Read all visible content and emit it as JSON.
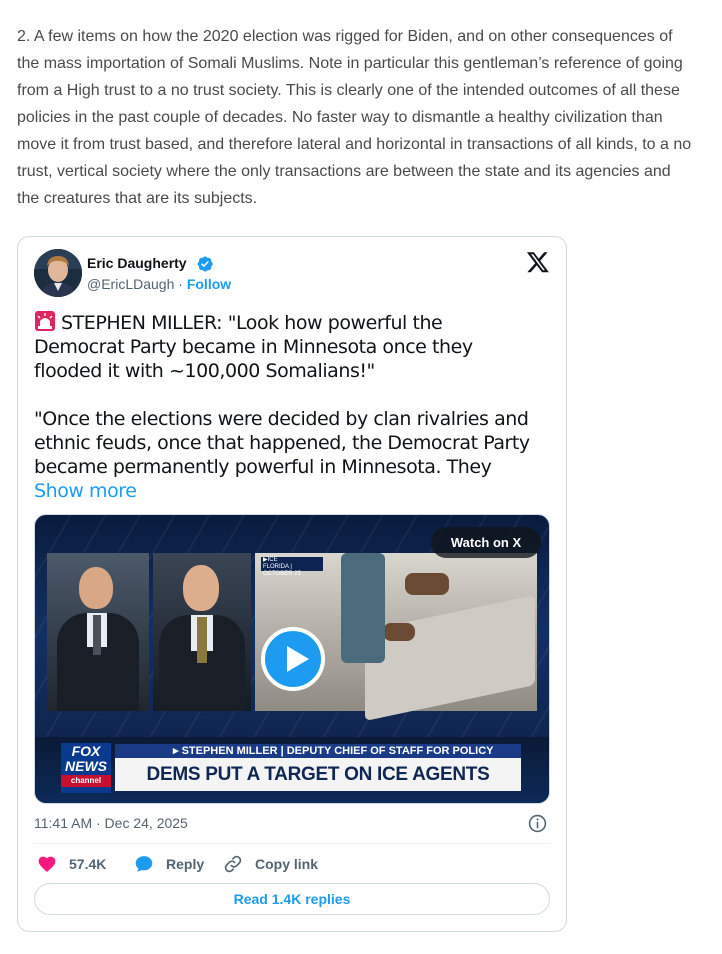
{
  "post": {
    "text": "2. A few items on how the 2020 election was rigged for Biden, and on other consequences of the mass importation of Somali Muslims. Note in particular this gentleman’s reference of going from a High trust to a no trust society. This is clearly one of the intended outcomes of all these policies in the past couple of decades. No faster way to dismantle a healthy civilization than move it from trust based, and therefore lateral and horizontal in transactions of all kinds, to a no trust, vertical society where the only transactions are between the state and its agencies and the creatures that are its subjects."
  },
  "tweet": {
    "author_name": "Eric Daugherty",
    "handle": "@EricLDaugh",
    "separator": " · ",
    "follow_label": "Follow",
    "paragraph1": "STEPHEN MILLER: \"Look how powerful the Democrat Party became in Minnesota once they flooded it with ~100,000 Somalians!\"",
    "paragraph2": "\"Once the elections were decided by clan rivalries and ethnic feuds, once that happened, the Democrat Party became permanently powerful in Minnesota. They ",
    "show_more": "Show more",
    "timestamp": "11:41 AM · Dec 24, 2025",
    "likes": "57.4K",
    "reply_label": "Reply",
    "copy_link_label": "Copy link",
    "read_replies": "Read 1.4K replies"
  },
  "media": {
    "watch_label": "Watch on X",
    "fox_logo_line1": "FOX",
    "fox_logo_line2": "NEWS",
    "fox_logo_line3": "channel",
    "chyron_top": "▸ STEPHEN MILLER | DEPUTY CHIEF OF STAFF FOR POLICY",
    "chyron_main": "DEMS PUT A TARGET ON ICE AGENTS",
    "ice_tag_line1": "▶ICE",
    "ice_tag_line2": "FLORIDA | OCTOBER 25"
  },
  "colors": {
    "accent": "#1d9bf0",
    "like": "#f91880",
    "text": "#0f1419",
    "muted": "#536471"
  },
  "icons": [
    "verified-badge-icon",
    "x-logo-icon",
    "siren-icon",
    "play-icon",
    "info-icon",
    "heart-icon",
    "reply-bubble-icon",
    "link-icon"
  ]
}
